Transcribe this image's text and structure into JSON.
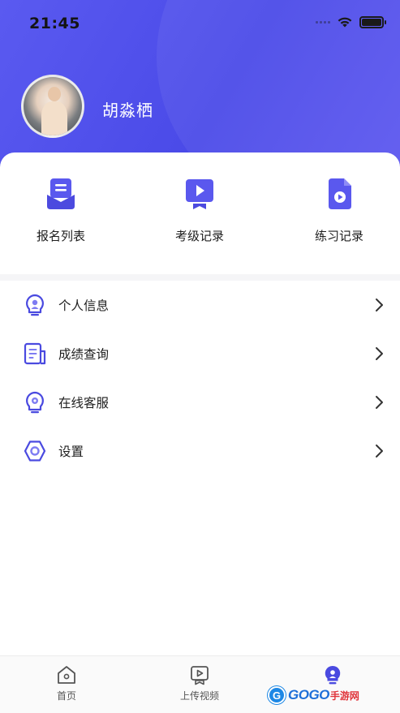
{
  "status_bar": {
    "time": "21:45"
  },
  "profile": {
    "name": "胡淼栖"
  },
  "quick_actions": [
    {
      "label": "报名列表",
      "icon": "envelope-list-icon"
    },
    {
      "label": "考级记录",
      "icon": "video-play-icon"
    },
    {
      "label": "练习记录",
      "icon": "video-file-icon"
    }
  ],
  "menu": [
    {
      "label": "个人信息",
      "icon": "bulb-person-icon"
    },
    {
      "label": "成绩查询",
      "icon": "document-icon"
    },
    {
      "label": "在线客服",
      "icon": "headset-icon"
    },
    {
      "label": "设置",
      "icon": "settings-hexagon-icon"
    }
  ],
  "tabbar": [
    {
      "label": "首页",
      "icon": "home-icon"
    },
    {
      "label": "上传视频",
      "icon": "upload-video-icon"
    },
    {
      "label": "",
      "icon": "profile-bulb-icon"
    }
  ],
  "watermark": {
    "logo": "G",
    "text": "GOGO",
    "sub": "手游网"
  },
  "colors": {
    "accent": "#5a58ee",
    "header": "#4a4ae8",
    "text": "#1e1e1e"
  }
}
